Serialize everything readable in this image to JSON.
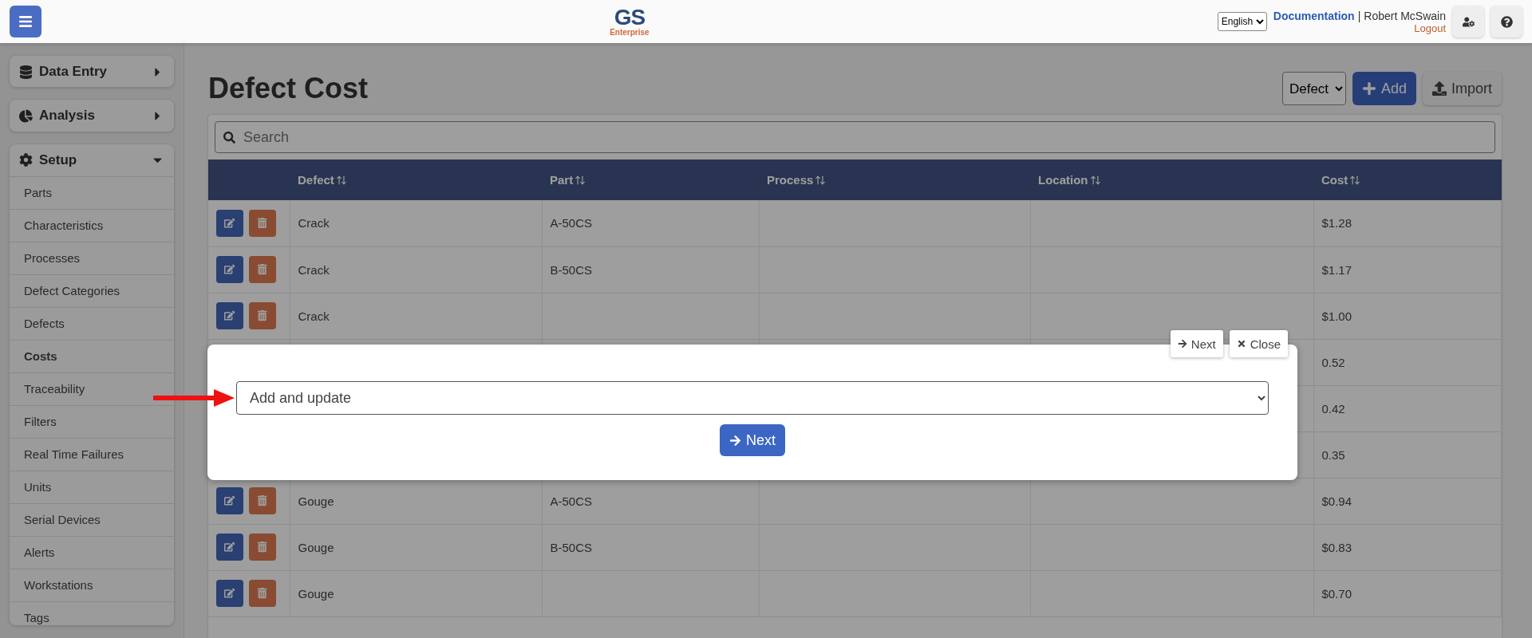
{
  "topbar": {
    "logo_title": "GS",
    "logo_subtitle": "Enterprise",
    "language": "English",
    "documentation": "Documentation",
    "separator": "|",
    "user": "Robert McSwain",
    "logout": "Logout"
  },
  "sidebar": {
    "sections": [
      {
        "label": "Data Entry",
        "expanded": false
      },
      {
        "label": "Analysis",
        "expanded": false
      },
      {
        "label": "Setup",
        "expanded": true,
        "items": [
          {
            "label": "Parts",
            "selected": false
          },
          {
            "label": "Characteristics",
            "selected": false
          },
          {
            "label": "Processes",
            "selected": false
          },
          {
            "label": "Defect Categories",
            "selected": false
          },
          {
            "label": "Defects",
            "selected": false
          },
          {
            "label": "Costs",
            "selected": true
          },
          {
            "label": "Traceability",
            "selected": false
          },
          {
            "label": "Filters",
            "selected": false
          },
          {
            "label": "Real Time Failures",
            "selected": false
          },
          {
            "label": "Units",
            "selected": false
          },
          {
            "label": "Serial Devices",
            "selected": false
          },
          {
            "label": "Alerts",
            "selected": false
          },
          {
            "label": "Workstations",
            "selected": false
          },
          {
            "label": "Tags",
            "selected": false
          }
        ]
      }
    ]
  },
  "page": {
    "title": "Defect Cost",
    "filter": "Defect",
    "add": "Add",
    "import": "Import"
  },
  "search": {
    "placeholder": "Search"
  },
  "table": {
    "columns": [
      "Defect",
      "Part",
      "Process",
      "Location",
      "Cost"
    ],
    "rows": [
      {
        "kind": "entry",
        "defect": "Crack",
        "part": "A-50CS",
        "cost": "$1.28"
      },
      {
        "kind": "entry",
        "defect": "Crack",
        "part": "B-50CS",
        "cost": "$1.17"
      },
      {
        "kind": "entry",
        "defect": "Crack",
        "cost": "$1.00"
      },
      {
        "kind": "covered",
        "cost": "0.52"
      },
      {
        "kind": "covered",
        "cost": "0.42"
      },
      {
        "kind": "covered",
        "cost": "0.35"
      },
      {
        "kind": "entry",
        "defect": "Gouge",
        "part": "A-50CS",
        "cost": "$0.94"
      },
      {
        "kind": "entry",
        "defect": "Gouge",
        "part": "B-50CS",
        "cost": "$0.83"
      },
      {
        "kind": "entry",
        "defect": "Gouge",
        "cost": "$0.70"
      }
    ]
  },
  "tour": {
    "next": "Next",
    "close": "Close",
    "select": "Add and update",
    "action": "Next"
  }
}
